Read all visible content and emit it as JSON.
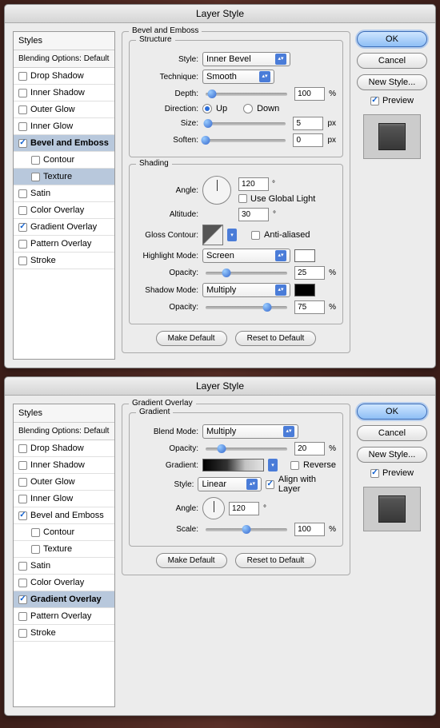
{
  "dialogs": [
    {
      "title": "Layer Style",
      "selected_style": "bevel",
      "selected_sub": "texture",
      "styles_header": "Styles",
      "blending_label": "Blending Options: Default",
      "style_items": [
        {
          "key": "drop_shadow",
          "label": "Drop Shadow",
          "checked": false
        },
        {
          "key": "inner_shadow",
          "label": "Inner Shadow",
          "checked": false
        },
        {
          "key": "outer_glow",
          "label": "Outer Glow",
          "checked": false
        },
        {
          "key": "inner_glow",
          "label": "Inner Glow",
          "checked": false
        },
        {
          "key": "bevel",
          "label": "Bevel and Emboss",
          "checked": true
        },
        {
          "key": "contour",
          "label": "Contour",
          "checked": false,
          "sub": true
        },
        {
          "key": "texture",
          "label": "Texture",
          "checked": false,
          "sub": true
        },
        {
          "key": "satin",
          "label": "Satin",
          "checked": false
        },
        {
          "key": "color_overlay",
          "label": "Color Overlay",
          "checked": false
        },
        {
          "key": "gradient_overlay",
          "label": "Gradient Overlay",
          "checked": true
        },
        {
          "key": "pattern_overlay",
          "label": "Pattern Overlay",
          "checked": false
        },
        {
          "key": "stroke",
          "label": "Stroke",
          "checked": false
        }
      ],
      "panel": {
        "heading": "Bevel and Emboss",
        "structure": {
          "legend": "Structure",
          "style_label": "Style:",
          "style_value": "Inner Bevel",
          "technique_label": "Technique:",
          "technique_value": "Smooth",
          "depth_label": "Depth:",
          "depth_value": "100",
          "depth_unit": "%",
          "direction_label": "Direction:",
          "up_label": "Up",
          "down_label": "Down",
          "direction": "up",
          "size_label": "Size:",
          "size_value": "5",
          "size_unit": "px",
          "soften_label": "Soften:",
          "soften_value": "0",
          "soften_unit": "px"
        },
        "shading": {
          "legend": "Shading",
          "angle_label": "Angle:",
          "angle_value": "120",
          "angle_unit": "°",
          "global_light_label": "Use Global Light",
          "global_light": false,
          "altitude_label": "Altitude:",
          "altitude_value": "30",
          "altitude_unit": "°",
          "gloss_label": "Gloss Contour:",
          "antialiased_label": "Anti-aliased",
          "antialiased": false,
          "highlight_label": "Highlight Mode:",
          "highlight_value": "Screen",
          "highlight_color": "#ffffff",
          "h_opacity_label": "Opacity:",
          "h_opacity_value": "25",
          "h_opacity_unit": "%",
          "shadow_label": "Shadow Mode:",
          "shadow_value": "Multiply",
          "shadow_color": "#000000",
          "s_opacity_label": "Opacity:",
          "s_opacity_value": "75",
          "s_opacity_unit": "%"
        },
        "make_default": "Make Default",
        "reset_default": "Reset to Default"
      },
      "buttons": {
        "ok": "OK",
        "cancel": "Cancel",
        "new_style": "New Style...",
        "preview": "Preview",
        "preview_checked": true
      }
    },
    {
      "title": "Layer Style",
      "selected_style": "gradient_overlay",
      "styles_header": "Styles",
      "blending_label": "Blending Options: Default",
      "style_items": [
        {
          "key": "drop_shadow",
          "label": "Drop Shadow",
          "checked": false
        },
        {
          "key": "inner_shadow",
          "label": "Inner Shadow",
          "checked": false
        },
        {
          "key": "outer_glow",
          "label": "Outer Glow",
          "checked": false
        },
        {
          "key": "inner_glow",
          "label": "Inner Glow",
          "checked": false
        },
        {
          "key": "bevel",
          "label": "Bevel and Emboss",
          "checked": true
        },
        {
          "key": "contour",
          "label": "Contour",
          "checked": false,
          "sub": true
        },
        {
          "key": "texture",
          "label": "Texture",
          "checked": false,
          "sub": true
        },
        {
          "key": "satin",
          "label": "Satin",
          "checked": false
        },
        {
          "key": "color_overlay",
          "label": "Color Overlay",
          "checked": false
        },
        {
          "key": "gradient_overlay",
          "label": "Gradient Overlay",
          "checked": true
        },
        {
          "key": "pattern_overlay",
          "label": "Pattern Overlay",
          "checked": false
        },
        {
          "key": "stroke",
          "label": "Stroke",
          "checked": false
        }
      ],
      "panel": {
        "heading": "Gradient Overlay",
        "gradient": {
          "legend": "Gradient",
          "blend_label": "Blend Mode:",
          "blend_value": "Multiply",
          "opacity_label": "Opacity:",
          "opacity_value": "20",
          "opacity_unit": "%",
          "gradient_label": "Gradient:",
          "reverse_label": "Reverse",
          "reverse": false,
          "style_label": "Style:",
          "style_value": "Linear",
          "align_label": "Align with Layer",
          "align": true,
          "angle_label": "Angle:",
          "angle_value": "120",
          "angle_unit": "°",
          "scale_label": "Scale:",
          "scale_value": "100",
          "scale_unit": "%"
        },
        "make_default": "Make Default",
        "reset_default": "Reset to Default"
      },
      "buttons": {
        "ok": "OK",
        "cancel": "Cancel",
        "new_style": "New Style...",
        "preview": "Preview",
        "preview_checked": true
      }
    }
  ]
}
